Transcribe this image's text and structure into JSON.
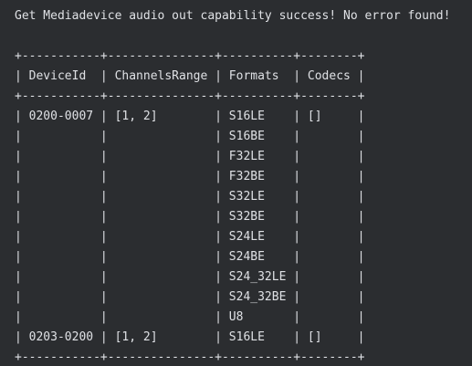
{
  "terminal": {
    "message": "Get Mediadevice audio out capability success! No error found!",
    "table_lines": [
      "+-----------+---------------+----------+--------+",
      "| DeviceId  | ChannelsRange | Formats  | Codecs |",
      "+-----------+---------------+----------+--------+",
      "| 0200-0007 | [1, 2]        | S16LE    | []     |",
      "|           |               | S16BE    |        |",
      "|           |               | F32LE    |        |",
      "|           |               | F32BE    |        |",
      "|           |               | S32LE    |        |",
      "|           |               | S32BE    |        |",
      "|           |               | S24LE    |        |",
      "|           |               | S24BE    |        |",
      "|           |               | S24_32LE |        |",
      "|           |               | S24_32BE |        |",
      "|           |               | U8       |        |",
      "| 0203-0200 | [1, 2]        | S16LE    | []     |",
      "+-----------+---------------+----------+--------+"
    ]
  }
}
